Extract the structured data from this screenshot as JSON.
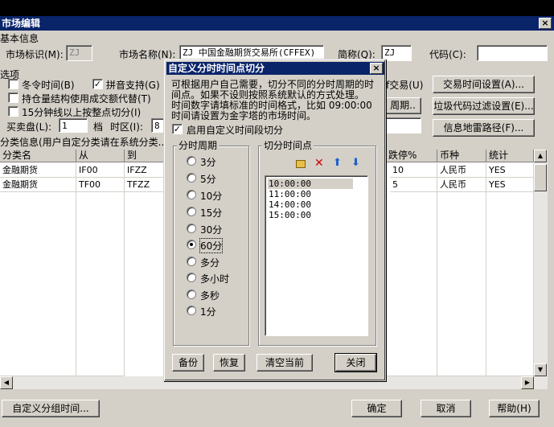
{
  "window": {
    "title": "市场编辑",
    "close_glyph": "×"
  },
  "basic": {
    "group_title": "基本信息",
    "market_id_label": "市场标识(M):",
    "market_id_value": "ZJ",
    "market_name_label": "市场名称(N):",
    "market_name_value": "ZJ 中国金融期货交易所(CFFEX)",
    "short_label": "简称(Q):",
    "short_value": "ZJ",
    "code_label": "代码(C):",
    "code_value": ""
  },
  "options": {
    "group_title": "选项",
    "cb_wintime": "冬令时间(B)",
    "cb_pinyin": "拼音支持(G)",
    "cb_oi": "持仓量结构使用成交额代替(T)",
    "cb_15min": "15分钟线以上按整点切分(I)",
    "trade_right": "f交易(U)",
    "bid_ask_label": "买卖盘(L):",
    "bid_ask_value": "1",
    "level_label": "档",
    "tz_label": "时区(I):",
    "tz_value": "8",
    "period_btn": "周期.."
  },
  "right_buttons": {
    "trade_time": "交易时间设置(A)...",
    "junk_filter": "垃圾代码过滤设置(E)...",
    "mine_path": "信息地雷路径(F)..."
  },
  "category": {
    "title": "分类信息(用户自定分类请在系统分类...",
    "columns": [
      "分类名",
      "从",
      "到",
      "跌停%",
      "币种",
      "统计"
    ],
    "rows": [
      {
        "name": "金融期货",
        "from": "IF00",
        "to": "IFZZ",
        "limit": "10",
        "currency": "人民币",
        "stat": "YES"
      },
      {
        "name": "金融期货",
        "from": "TF00",
        "to": "TFZZ",
        "limit": "5",
        "currency": "人民币",
        "stat": "YES"
      }
    ]
  },
  "bottom": {
    "custom_group": "自定义分组时间...",
    "ok": "确定",
    "cancel": "取消",
    "help": "帮助(H)"
  },
  "dialog": {
    "title": "自定义分时时间点切分",
    "desc1": "可根据用户自己需要，切分不同的分时周期的时",
    "desc2": "间点。如果不设则按照系统默认的方式处理。",
    "desc3": "时间数字请填标准的时间格式，比如 09:00:00",
    "desc4": "时间请设置为金字塔的市场时间。",
    "enable_label": "启用自定义时间段切分",
    "period_group": "分时周期",
    "periods": [
      "3分",
      "5分",
      "10分",
      "15分",
      "30分",
      "60分",
      "多分",
      "多小时",
      "多秒",
      "1分"
    ],
    "selected_period": "60分",
    "cut_group": "切分时间点",
    "times": [
      "10:00:00",
      "11:00:00",
      "14:00:00",
      "15:00:00"
    ],
    "btn_backup": "备份",
    "btn_restore": "恢复",
    "btn_clear": "清空当前",
    "btn_close": "关闭"
  }
}
